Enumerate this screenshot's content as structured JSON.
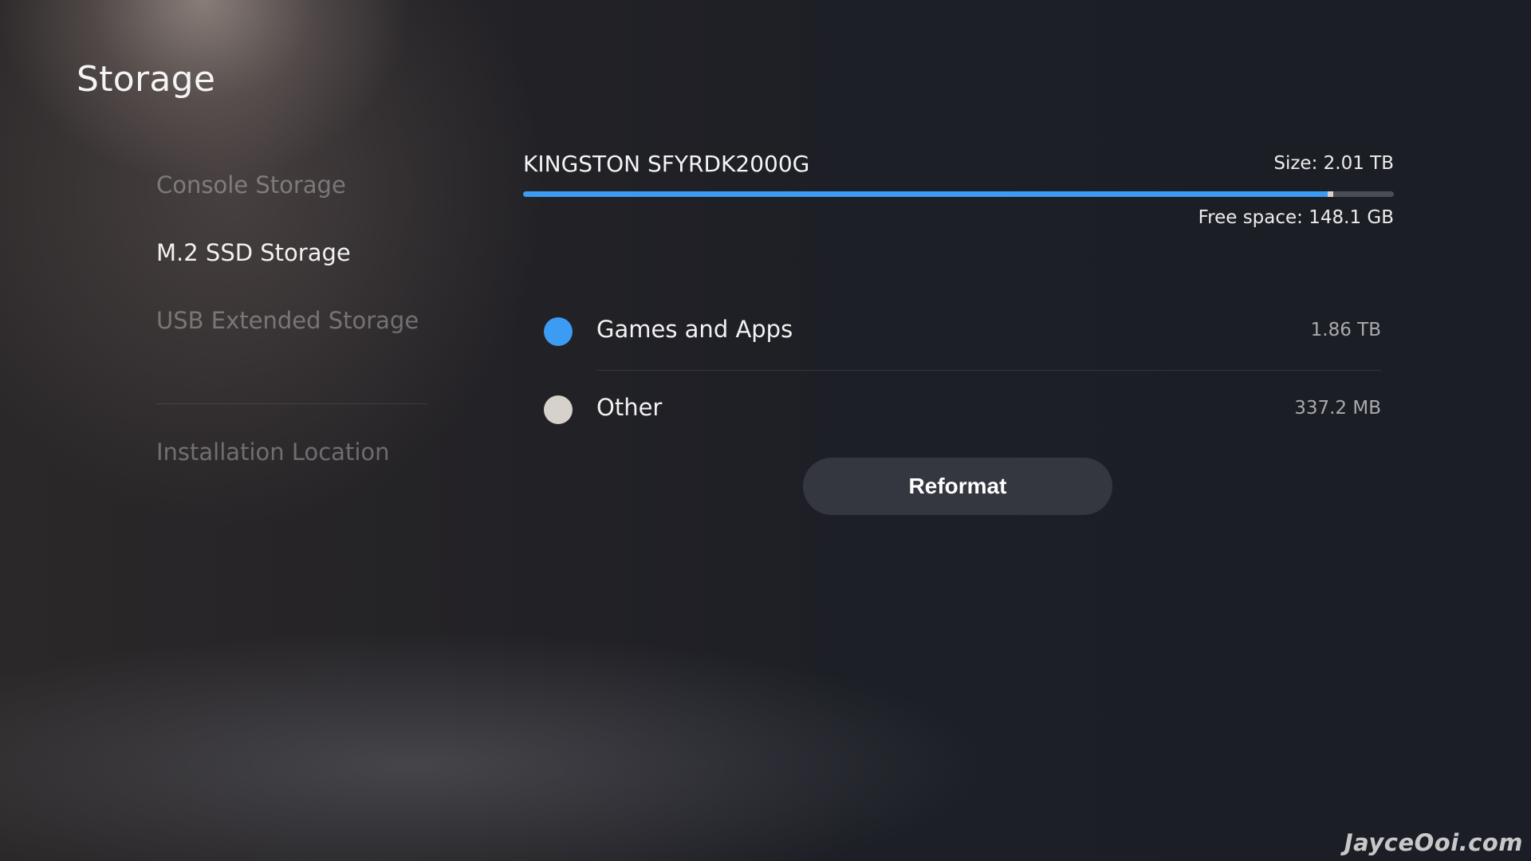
{
  "page": {
    "title": "Storage"
  },
  "sidebar": {
    "items": [
      {
        "label": "Console Storage",
        "active": false
      },
      {
        "label": "M.2 SSD Storage",
        "active": true
      },
      {
        "label": "USB Extended Storage",
        "active": false
      },
      {
        "label": "Installation Location",
        "active": false
      }
    ]
  },
  "drive": {
    "name": "KINGSTON SFYRDK2000G",
    "size_label": "Size:",
    "size_value": "2.01 TB",
    "free_label": "Free space:",
    "free_value": "148.1 GB",
    "usage_bar": {
      "games_fraction": 0.924,
      "other_fraction": 0.006
    },
    "categories": [
      {
        "name": "Games and Apps",
        "value": "1.86 TB",
        "color": "#3c9bf2"
      },
      {
        "name": "Other",
        "value": "337.2 MB",
        "color": "#d6d2cb"
      }
    ]
  },
  "actions": {
    "reformat_label": "Reformat"
  },
  "watermark": {
    "text": "JayceOoi.com"
  }
}
